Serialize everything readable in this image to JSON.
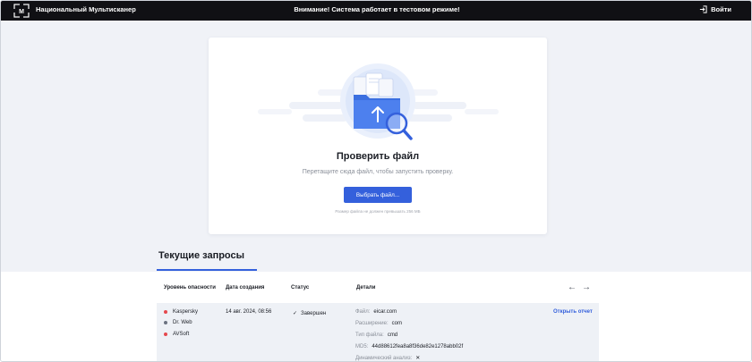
{
  "header": {
    "brand": "Национальный Мультисканер",
    "notice": "Внимание! Система работает в тестовом режиме!",
    "login": "Войти"
  },
  "upload": {
    "title": "Проверить файл",
    "hint": "Перетащите сюда файл, чтобы запустить проверку.",
    "button": "Выбрать файл...",
    "limit": "Размер файла не должен превышать 256 МБ"
  },
  "requests": {
    "title": "Текущие запросы",
    "columns": [
      "Уровень опасности",
      "Дата создания",
      "Статус",
      "Детали"
    ],
    "rows": [
      {
        "engines": [
          {
            "name": "Kaspersky",
            "color": "#e5484d"
          },
          {
            "name": "Dr. Web",
            "color": "#6b7280"
          },
          {
            "name": "AVSoft",
            "color": "#e5484d"
          }
        ],
        "date": "14 авг. 2024, 08:56",
        "status": "Завершен",
        "details": {
          "file_label": "Файл:",
          "file": "eicar.com",
          "ext_label": "Расширение:",
          "ext": "com",
          "type_label": "Тип файла:",
          "type": "cmd",
          "md5_label": "MD5:",
          "md5": "44d88612fea8a8f36de82e1278abb02f",
          "dyn_label": "Динамический анализ:",
          "dyn": "✕"
        },
        "action": "Открыть отчет"
      }
    ]
  },
  "colors": {
    "accent": "#3460dc",
    "header_bg": "#101014",
    "page_bg": "#f0f2f7"
  }
}
